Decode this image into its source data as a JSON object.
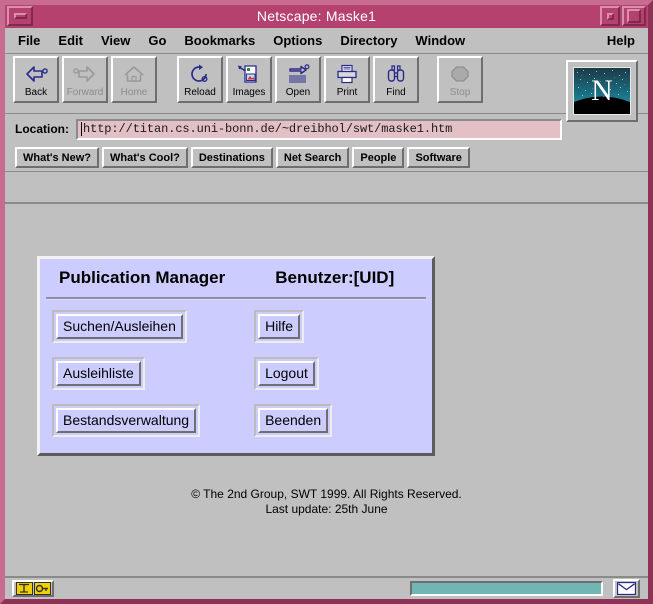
{
  "window": {
    "title": "Netscape: Maske1",
    "minimize_label": "minimize",
    "restore_label": "restore",
    "maximize_label": "maximize"
  },
  "menubar": {
    "items": [
      {
        "label": "File"
      },
      {
        "label": "Edit"
      },
      {
        "label": "View"
      },
      {
        "label": "Go"
      },
      {
        "label": "Bookmarks"
      },
      {
        "label": "Options"
      },
      {
        "label": "Directory"
      },
      {
        "label": "Window"
      }
    ],
    "help_label": "Help"
  },
  "toolbar": {
    "buttons": [
      {
        "label": "Back",
        "icon": "back-arrow-icon",
        "disabled": false
      },
      {
        "label": "Forward",
        "icon": "forward-arrow-icon",
        "disabled": true
      },
      {
        "label": "Home",
        "icon": "house-icon",
        "disabled": true
      },
      {
        "label": "Reload",
        "icon": "reload-icon",
        "disabled": false
      },
      {
        "label": "Images",
        "icon": "images-icon",
        "disabled": false
      },
      {
        "label": "Open",
        "icon": "open-icon",
        "disabled": false
      },
      {
        "label": "Print",
        "icon": "printer-icon",
        "disabled": false
      },
      {
        "label": "Find",
        "icon": "binoculars-icon",
        "disabled": false
      },
      {
        "label": "Stop",
        "icon": "stop-octagon-icon",
        "disabled": true
      }
    ],
    "logo_letter": "N",
    "logo_name": "netscape-logo"
  },
  "location": {
    "label": "Location:",
    "value": "http://titan.cs.uni-bonn.de/~dreibhol/swt/maske1.htm"
  },
  "directory": {
    "buttons": [
      {
        "label": "What's New?"
      },
      {
        "label": "What's Cool?"
      },
      {
        "label": "Destinations"
      },
      {
        "label": "Net Search"
      },
      {
        "label": "People"
      },
      {
        "label": "Software"
      }
    ]
  },
  "page": {
    "panel": {
      "title": "Publication Manager",
      "user": "Benutzer:[UID]",
      "left_buttons": [
        {
          "label": "Suchen/Ausleihen"
        },
        {
          "label": "Ausleihliste"
        },
        {
          "label": "Bestandsverwaltung"
        }
      ],
      "right_buttons": [
        {
          "label": "Hilfe"
        },
        {
          "label": "Logout"
        },
        {
          "label": "Beenden"
        }
      ]
    },
    "footer": {
      "copyright": "© The 2nd Group, SWT 1999. All Rights Reserved.",
      "last_update": "Last update: 25th June"
    }
  },
  "statusbar": {
    "security_icon": "security-key-icon",
    "progress_name": "progress-bar",
    "mail_icon": "mail-envelope-icon"
  },
  "colors": {
    "title_bar": "#b5416e",
    "face": "#c0c0c0",
    "panel_face": "#ccccff",
    "location_field": "#e3bfc6",
    "progress": "#72b5b5"
  }
}
